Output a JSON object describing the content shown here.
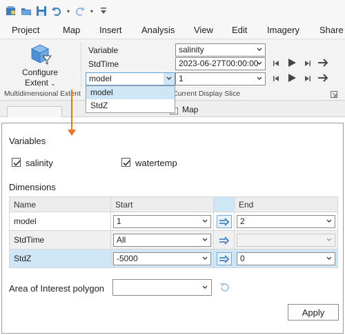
{
  "ribbon": {
    "tabs": [
      "Project",
      "Map",
      "Insert",
      "Analysis",
      "View",
      "Edit",
      "Imagery",
      "Share"
    ],
    "configure_label_1": "Configure",
    "configure_label_2": "Extent",
    "group_label_left": "Multidimensional Extent",
    "group_label_right": "Current Display Slice",
    "variable_label": "Variable",
    "stdtime_label": "StdTime",
    "variable_value": "salinity",
    "stdtime_value": "2023-06-27T00:00:00",
    "model_value": "1",
    "dimension_select": "model",
    "dropdown_options": [
      "model",
      "StdZ"
    ],
    "map_tab_label": "Map"
  },
  "dialog": {
    "variables_heading": "Variables",
    "variables": [
      {
        "label": "salinity",
        "checked": true
      },
      {
        "label": "watertemp",
        "checked": true
      }
    ],
    "dimensions_heading": "Dimensions",
    "columns": [
      "Name",
      "Start",
      "",
      "End"
    ],
    "rows": [
      {
        "name": "model",
        "start": "1",
        "end": "2",
        "state": "normal"
      },
      {
        "name": "StdTime",
        "start": "All",
        "end": "",
        "state": "disabled"
      },
      {
        "name": "StdZ",
        "start": "-5000",
        "end": "0",
        "state": "selected"
      }
    ],
    "aoi_label": "Area of Interest polygon",
    "aoi_value": "",
    "apply_label": "Apply"
  },
  "colors": {
    "accent": "#e87722",
    "selection": "#cfe6f7",
    "play_dark": "#444444"
  },
  "icons": [
    "save-icon",
    "open-icon",
    "print-icon",
    "undo-icon",
    "redo-icon",
    "customize-icon",
    "configure-extent-icon",
    "skip-back-icon",
    "play-icon",
    "step-forward-icon",
    "next-arrow-icon",
    "sync-arrow-icon",
    "refresh-icon",
    "checkmark-icon",
    "dialog-launcher-icon"
  ]
}
